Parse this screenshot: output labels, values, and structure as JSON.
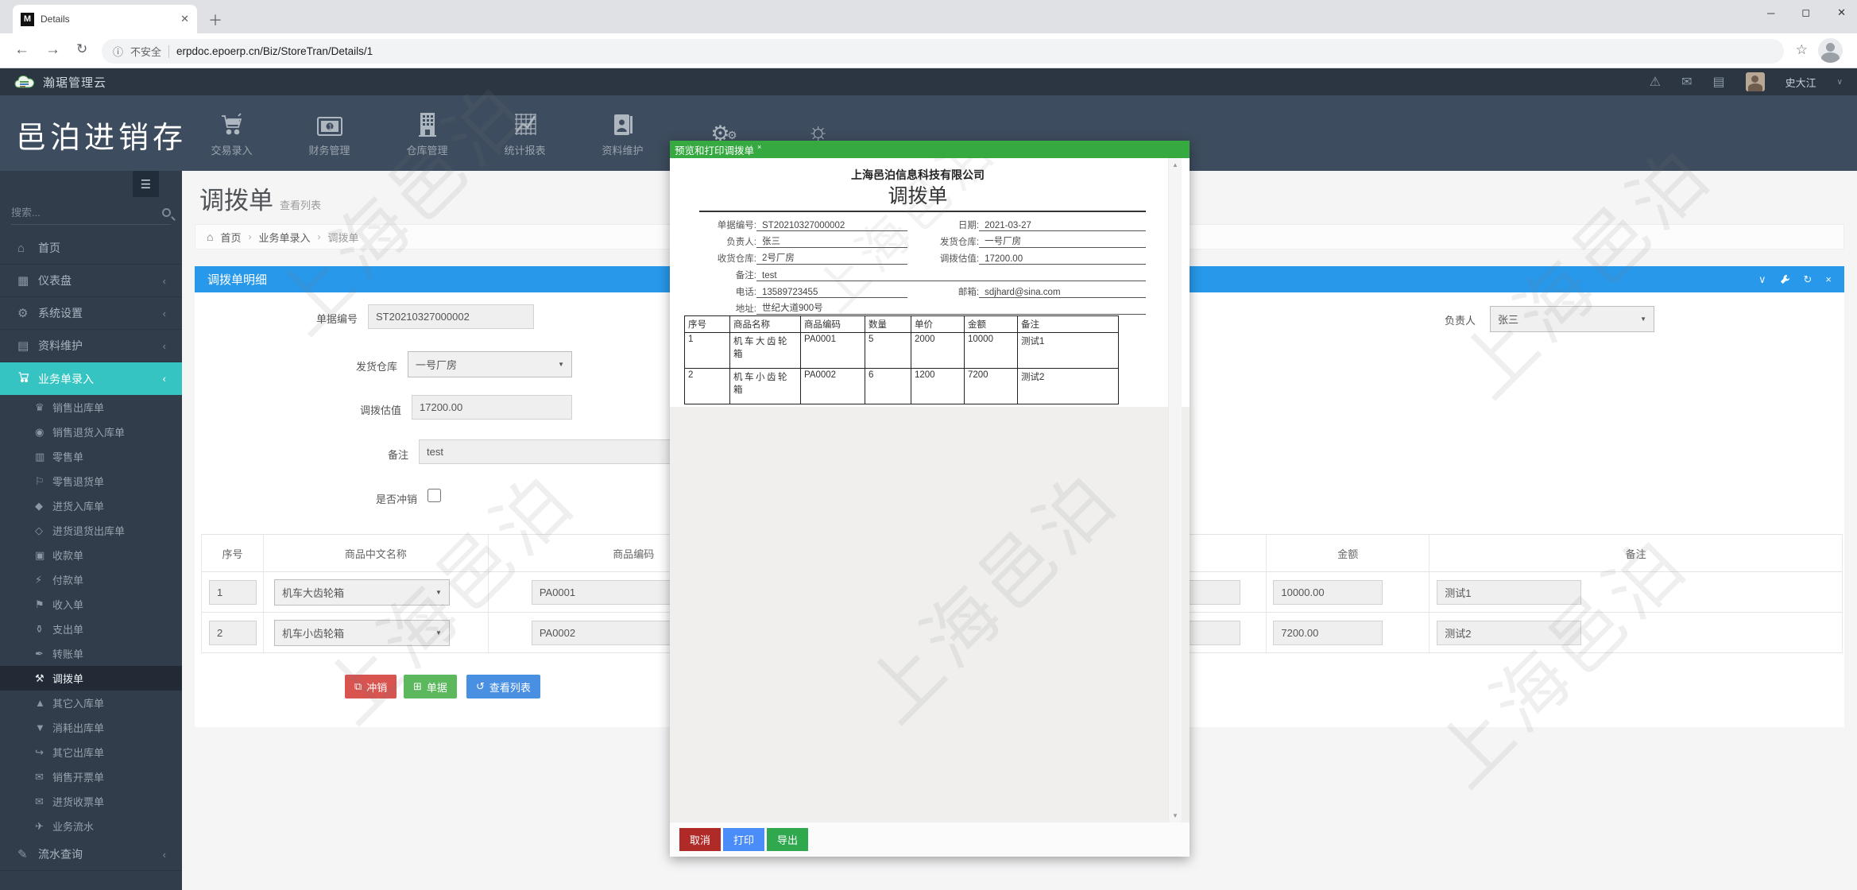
{
  "browser": {
    "tab_title": "Details",
    "favicon_letter": "M",
    "security_label": "不安全",
    "url": "erpdoc.epoerp.cn/Biz/StoreTran/Details/1"
  },
  "app_header": {
    "brand": "瀚琚管理云",
    "user_name": "史大江"
  },
  "side_brand": "邑泊进销存",
  "top_nav": {
    "items": [
      {
        "label": "交易录入"
      },
      {
        "label": "财务管理"
      },
      {
        "label": "仓库管理"
      },
      {
        "label": "统计报表"
      },
      {
        "label": "资料维护"
      },
      {
        "label": ""
      },
      {
        "label": ""
      }
    ]
  },
  "sidebar": {
    "search_placeholder": "搜索...",
    "items": [
      {
        "label": "首页"
      },
      {
        "label": "仪表盘"
      },
      {
        "label": "系统设置"
      },
      {
        "label": "资料维护"
      },
      {
        "label": "业务单录入"
      }
    ],
    "submenu": [
      {
        "label": "销售出库单"
      },
      {
        "label": "销售退货入库单"
      },
      {
        "label": "零售单"
      },
      {
        "label": "零售退货单"
      },
      {
        "label": "进货入库单"
      },
      {
        "label": "进货退货出库单"
      },
      {
        "label": "收款单"
      },
      {
        "label": "付款单"
      },
      {
        "label": "收入单"
      },
      {
        "label": "支出单"
      },
      {
        "label": "转账单"
      },
      {
        "label": "调拨单"
      },
      {
        "label": "其它入库单"
      },
      {
        "label": "消耗出库单"
      },
      {
        "label": "其它出库单"
      },
      {
        "label": "销售开票单"
      },
      {
        "label": "进货收票单"
      },
      {
        "label": "业务流水"
      }
    ],
    "bottom_item": "流水查询"
  },
  "page": {
    "title": "调拨单",
    "subtitle": "查看列表",
    "breadcrumb": [
      "首页",
      "业务单录入",
      "调拨单"
    ]
  },
  "panel": {
    "title": "调拨单明细",
    "form": {
      "doc_no_label": "单据编号",
      "doc_no": "ST20210327000002",
      "from_wh_label": "发货仓库",
      "from_wh": "一号厂房",
      "value_label": "调拨估值",
      "value": "17200.00",
      "note_label": "备注",
      "note": "test",
      "writeoff_label": "是否冲销",
      "manager_label": "负责人",
      "manager": "张三"
    },
    "table": {
      "headers": [
        "序号",
        "商品中文名称",
        "商品编码",
        "",
        "",
        "金额",
        "备注"
      ],
      "rows": [
        {
          "no": "1",
          "name": "机车大齿轮箱",
          "code": "PA0001",
          "amount": "10000.00",
          "note": "测试1"
        },
        {
          "no": "2",
          "name": "机车小齿轮箱",
          "code": "PA0002",
          "amount": "7200.00",
          "note": "测试2"
        }
      ]
    },
    "buttons": {
      "writeoff": "冲销",
      "doc": "单据",
      "list": "查看列表"
    }
  },
  "modal": {
    "title": "预览和打印调拨单",
    "company": "上海邑泊信息科技有限公司",
    "doc_title": "调拨单",
    "fields": {
      "r1l_label": "单据编号:",
      "r1l": "ST20210327000002",
      "r1r_label": "日期:",
      "r1r": "2021-03-27",
      "r2l_label": "负责人:",
      "r2l": "张三",
      "r2r_label": "发货仓库:",
      "r2r": "一号厂房",
      "r3l_label": "收货仓库:",
      "r3l": "2号厂房",
      "r3r_label": "调拨估值:",
      "r3r": "17200.00",
      "r4_label": "备注:",
      "r4": "test",
      "r5l_label": "电话:",
      "r5l": "13589723455",
      "r5r_label": "邮箱:",
      "r5r": "sdjhard@sina.com",
      "r6_label": "地址:",
      "r6": "世纪大道900号"
    },
    "table": {
      "headers": [
        "序号",
        "商品名称",
        "商品编码",
        "数量",
        "单价",
        "金额",
        "备注"
      ],
      "rows": [
        [
          "1",
          "机车大齿轮箱",
          "PA0001",
          "5",
          "2000",
          "10000",
          "测试1"
        ],
        [
          "2",
          "机车小齿轮箱",
          "PA0002",
          "6",
          "1200",
          "7200",
          "测试2"
        ]
      ]
    },
    "footer": {
      "cancel": "取消",
      "print": "打印",
      "export": "导出"
    }
  },
  "watermark": "上海邑泊",
  "colors": {
    "panel_header": "#2798ea",
    "sidebar_active": "#35c4c2",
    "modal_header": "#36a940",
    "btn_writeoff": "#d9534f",
    "btn_doc": "#5cb85c",
    "btn_list": "#4a90e2",
    "btn_cancel": "#b02b27",
    "btn_print": "#4b8df8",
    "btn_export": "#2fa84e"
  }
}
